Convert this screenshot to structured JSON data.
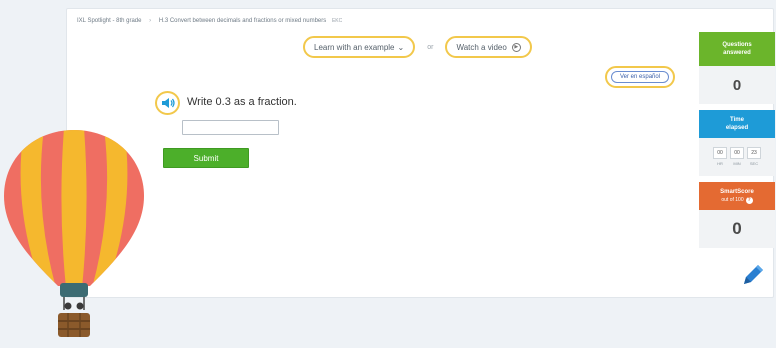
{
  "breadcrumb": {
    "course": "IXL Spotlight - 8th grade",
    "skill": "H.3 Convert between decimals and fractions or mixed numbers",
    "code": "EKC"
  },
  "help": {
    "learn_label": "Learn with an example",
    "or_label": "or",
    "video_label": "Watch a video"
  },
  "language": {
    "spanish_label": "Ver en español"
  },
  "question": {
    "prompt": "Write 0.3 as a fraction.",
    "answer_value": ""
  },
  "submit_label": "Submit",
  "sidebar": {
    "questions": {
      "title_line1": "Questions",
      "title_line2": "answered",
      "value": "0"
    },
    "time": {
      "title_line1": "Time",
      "title_line2": "elapsed",
      "hr": "00",
      "min": "00",
      "sec": "23",
      "hr_label": "HR",
      "min_label": "MIN",
      "sec_label": "SEC"
    },
    "smartscore": {
      "title": "SmartScore",
      "subtitle": "out of 100",
      "value": "0"
    }
  },
  "colors": {
    "highlight": "#f2c84b",
    "green": "#4caf2a",
    "blue": "#1e9bd7",
    "orange": "#e46a32"
  },
  "icons": [
    "speaker-icon",
    "chevron-down-icon",
    "play-circle-icon",
    "info-icon",
    "pencil-icon",
    "hot-air-balloon-icon"
  ]
}
